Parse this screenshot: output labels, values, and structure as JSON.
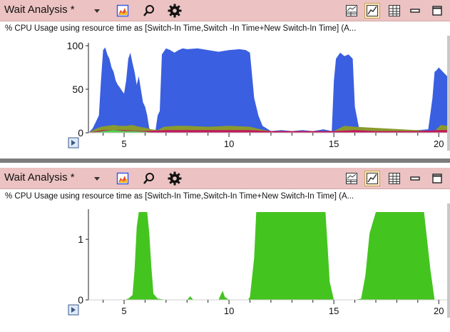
{
  "panels": [
    {
      "title": "Wait Analysis *",
      "subtitle": "% CPU Usage using resource time as [Switch-In Time,Switch -In Time+New Switch-In Time] (A...",
      "chart_data": {
        "type": "area",
        "xlim": [
          3.3,
          20.4
        ],
        "ylim": [
          0,
          100
        ],
        "x_ticks": [
          "5",
          "10",
          "15",
          "20"
        ],
        "y_ticks": [
          "0",
          "50",
          "100"
        ],
        "series": [
          {
            "color": "#3a5fe0",
            "x": [
              3.3,
              3.5,
              3.7,
              3.8,
              3.9,
              4.0,
              4.1,
              4.2,
              4.3,
              4.4,
              4.5,
              4.6,
              4.7,
              4.8,
              4.9,
              5.0,
              5.1,
              5.2,
              5.3,
              5.4,
              5.5,
              5.6,
              5.7,
              5.8,
              5.9,
              6.0,
              6.1,
              6.2,
              6.4,
              6.5,
              6.6,
              6.7,
              6.8,
              7.0,
              7.2,
              7.4,
              7.6,
              7.8,
              8.0,
              8.5,
              9.0,
              9.5,
              10.0,
              10.5,
              10.8,
              11.0,
              11.2,
              11.4,
              11.6,
              11.8,
              12.0,
              12.5,
              13.0,
              13.5,
              14.0,
              14.5,
              14.9,
              15.0,
              15.1,
              15.3,
              15.5,
              15.7,
              15.9,
              16.0,
              16.2,
              16.4,
              17.0,
              18.0,
              19.0,
              19.5,
              19.7,
              19.8,
              19.9,
              20.0,
              20.2,
              20.4
            ],
            "values": [
              0,
              5,
              15,
              20,
              60,
              95,
              98,
              90,
              85,
              75,
              70,
              60,
              55,
              52,
              48,
              45,
              60,
              85,
              92,
              80,
              70,
              55,
              65,
              50,
              35,
              30,
              20,
              5,
              2,
              3,
              20,
              25,
              90,
              97,
              95,
              92,
              95,
              97,
              96,
              97,
              95,
              93,
              95,
              96,
              95,
              92,
              40,
              20,
              8,
              5,
              2,
              3,
              2,
              3,
              2,
              4,
              2,
              60,
              85,
              92,
              88,
              90,
              85,
              30,
              5,
              2,
              3,
              2,
              3,
              4,
              40,
              70,
              72,
              75,
              70,
              65
            ]
          },
          {
            "color": "#8a9a2e",
            "x": [
              3.3,
              3.6,
              3.9,
              4.2,
              4.5,
              4.8,
              5.1,
              5.4,
              5.7,
              6.0,
              6.3,
              6.6,
              6.9,
              7.5,
              8.0,
              9.0,
              10.0,
              11.0,
              11.5,
              12.0,
              15.0,
              15.5,
              16.0,
              19.8,
              20.1,
              20.4
            ],
            "values": [
              0,
              4,
              7,
              8,
              9,
              8,
              8,
              9,
              7,
              6,
              4,
              3,
              7,
              8,
              8,
              7,
              8,
              7,
              4,
              2,
              2,
              8,
              7,
              2,
              9,
              8
            ]
          },
          {
            "color": "#c0185c",
            "x": [
              3.3,
              4.0,
              5.0,
              6.0,
              7.0,
              8.0,
              10.0,
              11.0,
              12.0,
              13.0,
              14.0,
              15.0,
              16.0,
              17.0,
              18.0,
              19.0,
              20.0,
              20.4
            ],
            "values": [
              0,
              3,
              3,
              2,
              3,
              3,
              3,
              3,
              2,
              2,
              2,
              2,
              3,
              2,
              2,
              2,
              3,
              3
            ]
          },
          {
            "color": "#4cd14c",
            "x": [
              3.3,
              3.8,
              4.0,
              4.5,
              5.0,
              5.5,
              6.0,
              6.5,
              7.0
            ],
            "values": [
              0,
              1,
              2,
              3,
              2,
              2,
              1,
              0,
              0
            ]
          }
        ]
      }
    },
    {
      "title": "Wait Analysis *",
      "subtitle": "% CPU Usage using resource time as [Switch-In Time,Switch-In Time+New Switch-In Time] (A...",
      "chart_data": {
        "type": "area",
        "xlim": [
          3.3,
          20.4
        ],
        "ylim": [
          0,
          1.45
        ],
        "x_ticks": [
          "5",
          "10",
          "15",
          "20"
        ],
        "y_ticks": [
          "0",
          "1"
        ],
        "series": [
          {
            "color": "#44c41f",
            "x": [
              3.3,
              4.5,
              5.0,
              5.2,
              5.4,
              5.5,
              5.6,
              5.7,
              6.1,
              6.2,
              6.3,
              6.4,
              6.6,
              7.0,
              7.5,
              8.0,
              8.15,
              8.3,
              8.6,
              9.0,
              9.5,
              9.6,
              9.7,
              9.8,
              10.0,
              10.5,
              10.9,
              11.0,
              11.2,
              11.3,
              12.0,
              14.0,
              14.6,
              14.7,
              14.8,
              15.0,
              16.0,
              16.3,
              16.5,
              16.7,
              17.0,
              19.0,
              19.3,
              19.6,
              19.8,
              20.4
            ],
            "values": [
              0,
              0,
              0,
              0.02,
              0.08,
              0.5,
              1.2,
              1.45,
              1.45,
              1.1,
              0.55,
              0.1,
              0.02,
              0,
              0,
              0,
              0.06,
              0,
              0,
              0,
              0,
              0.08,
              0.15,
              0.05,
              0,
              0,
              0,
              0.05,
              0.7,
              1.45,
              1.45,
              1.45,
              1.45,
              0.9,
              0.3,
              0,
              0,
              0.02,
              0.4,
              1.1,
              1.45,
              1.45,
              1.45,
              0.5,
              0,
              0
            ]
          }
        ]
      }
    }
  ],
  "icons": {
    "dropdown": "chevron-down-icon",
    "chart": "chart-type-icon",
    "search": "search-icon",
    "settings": "gear-icon",
    "graph_table": "graph-and-table-icon",
    "graph_only": "graph-only-icon",
    "table_only": "table-only-icon",
    "minimize": "minimize-icon",
    "maximize": "maximize-icon",
    "close": "close-icon",
    "expand": "expand-legend-icon"
  }
}
